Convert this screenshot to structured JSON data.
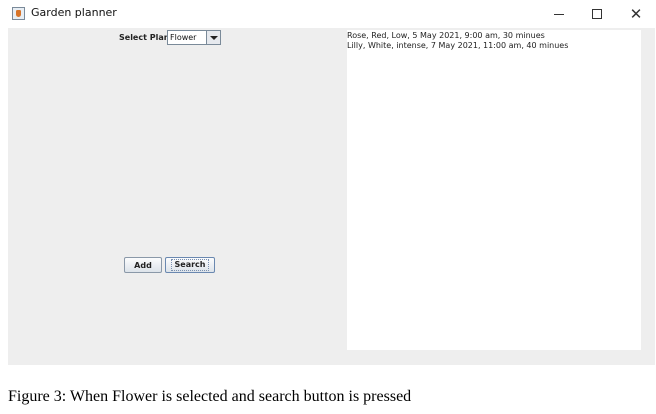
{
  "window": {
    "title": "Garden planner",
    "minimize_icon": "minimize-icon",
    "maximize_icon": "maximize-icon",
    "close_icon": "close-icon",
    "close_glyph": "✕"
  },
  "form": {
    "select_label": "Select Plant",
    "select_value": "Flower",
    "add_label": "Add",
    "search_label": "Search"
  },
  "results": {
    "lines": [
      "Rose, Red, Low, 5 May 2021, 9:00 am, 30 minues",
      "Lilly, White, intense, 7 May 2021, 11:00 am, 40 minues"
    ]
  },
  "caption": "Figure 3: When Flower is selected and search button is pressed"
}
